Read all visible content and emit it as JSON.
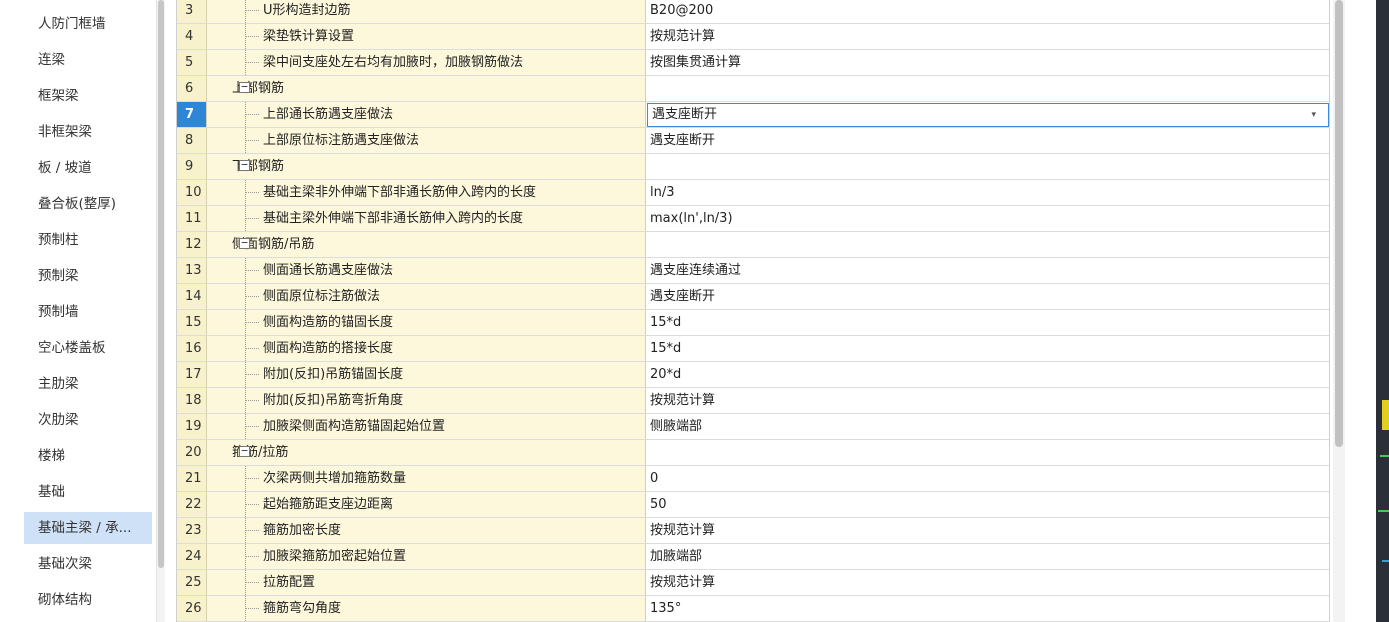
{
  "sidebar": {
    "items": [
      {
        "label": "人防门框墙"
      },
      {
        "label": "连梁"
      },
      {
        "label": "框架梁"
      },
      {
        "label": "非框架梁"
      },
      {
        "label": "板 / 坡道"
      },
      {
        "label": "叠合板(整厚)"
      },
      {
        "label": "预制柱"
      },
      {
        "label": "预制梁"
      },
      {
        "label": "预制墙"
      },
      {
        "label": "空心楼盖板"
      },
      {
        "label": "主肋梁"
      },
      {
        "label": "次肋梁"
      },
      {
        "label": "楼梯"
      },
      {
        "label": "基础"
      },
      {
        "label": "基础主梁 / 承..."
      },
      {
        "label": "基础次梁"
      },
      {
        "label": "砌体结构"
      }
    ],
    "selected_index": 14
  },
  "grid": {
    "rows": [
      {
        "num": "3",
        "name": "U形构造封边筋",
        "value": "B20@200",
        "type": "child"
      },
      {
        "num": "4",
        "name": "梁垫铁计算设置",
        "value": "按规范计算",
        "type": "child"
      },
      {
        "num": "5",
        "name": "梁中间支座处左右均有加腋时，加腋钢筋做法",
        "value": "按图集贯通计算",
        "type": "child"
      },
      {
        "num": "6",
        "name": "上部钢筋",
        "value": "",
        "type": "group",
        "toggle": "−"
      },
      {
        "num": "7",
        "name": "上部通长筋遇支座做法",
        "value": "遇支座断开",
        "type": "child",
        "selected": true
      },
      {
        "num": "8",
        "name": "上部原位标注筋遇支座做法",
        "value": "遇支座断开",
        "type": "child"
      },
      {
        "num": "9",
        "name": "下部钢筋",
        "value": "",
        "type": "group",
        "toggle": "−"
      },
      {
        "num": "10",
        "name": "基础主梁非外伸端下部非通长筋伸入跨内的长度",
        "value": "ln/3",
        "type": "child"
      },
      {
        "num": "11",
        "name": "基础主梁外伸端下部非通长筋伸入跨内的长度",
        "value": "max(ln',ln/3)",
        "type": "child"
      },
      {
        "num": "12",
        "name": "侧面钢筋/吊筋",
        "value": "",
        "type": "group",
        "toggle": "−"
      },
      {
        "num": "13",
        "name": "侧面通长筋遇支座做法",
        "value": "遇支座连续通过",
        "type": "child"
      },
      {
        "num": "14",
        "name": "侧面原位标注筋做法",
        "value": "遇支座断开",
        "type": "child"
      },
      {
        "num": "15",
        "name": "侧面构造筋的锚固长度",
        "value": "15*d",
        "type": "child"
      },
      {
        "num": "16",
        "name": "侧面构造筋的搭接长度",
        "value": "15*d",
        "type": "child"
      },
      {
        "num": "17",
        "name": "附加(反扣)吊筋锚固长度",
        "value": "20*d",
        "type": "child"
      },
      {
        "num": "18",
        "name": "附加(反扣)吊筋弯折角度",
        "value": "按规范计算",
        "type": "child"
      },
      {
        "num": "19",
        "name": "加腋梁侧面构造筋锚固起始位置",
        "value": "侧腋端部",
        "type": "child"
      },
      {
        "num": "20",
        "name": "箍筋/拉筋",
        "value": "",
        "type": "group",
        "toggle": "−"
      },
      {
        "num": "21",
        "name": "次梁两侧共增加箍筋数量",
        "value": "0",
        "type": "child"
      },
      {
        "num": "22",
        "name": "起始箍筋距支座边距离",
        "value": "50",
        "type": "child"
      },
      {
        "num": "23",
        "name": "箍筋加密长度",
        "value": "按规范计算",
        "type": "child"
      },
      {
        "num": "24",
        "name": "加腋梁箍筋加密起始位置",
        "value": "加腋端部",
        "type": "child"
      },
      {
        "num": "25",
        "name": "拉筋配置",
        "value": "按规范计算",
        "type": "child"
      },
      {
        "num": "26",
        "name": "箍筋弯勾角度",
        "value": "135°",
        "type": "child"
      }
    ]
  },
  "colors": {
    "selected_row": "#2f86d7",
    "name_background": "#fdf8dc",
    "number_background": "#f7f1cc",
    "sidebar_selected": "#cfe1f6"
  }
}
